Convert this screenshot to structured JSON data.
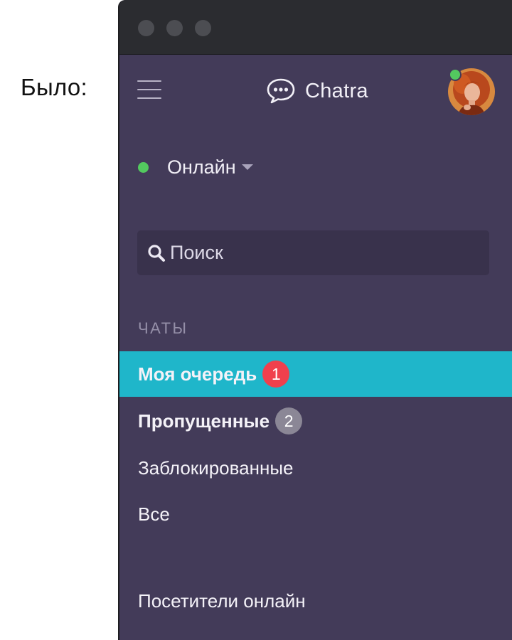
{
  "caption": "Было:",
  "app": {
    "name": "Chatra",
    "status_label": "Онлайн",
    "search_placeholder": "Поиск",
    "section_title": "ЧАТЫ",
    "items": [
      {
        "label": "Моя очередь",
        "badge": "1",
        "active": true
      },
      {
        "label": "Пропущенные",
        "badge": "2"
      },
      {
        "label": "Заблокированные"
      },
      {
        "label": "Все"
      },
      {
        "label": "Посетители онлайн"
      }
    ]
  },
  "colors": {
    "sidebar_bg": "#433b59",
    "active_item": "#1fb6ca",
    "online_green": "#53c95f",
    "badge_red": "#f0404d",
    "badge_gray": "#8b8796"
  },
  "icons": [
    "hamburger-menu-icon",
    "chat-bubble-logo-icon",
    "search-icon",
    "caret-down-icon"
  ]
}
